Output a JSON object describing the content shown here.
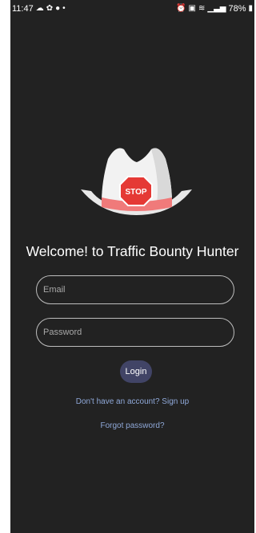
{
  "status_bar": {
    "time": "11:47",
    "battery": "78%"
  },
  "logo": {
    "sign_text": "STOP",
    "icon": "cowboy-hat-stop-sign"
  },
  "login": {
    "welcome": "Welcome! to Traffic Bounty Hunter",
    "email_placeholder": "Email",
    "password_placeholder": "Password",
    "login_label": "Login",
    "signup_link": "Don't have an account? Sign up",
    "forgot_link": "Forgot password?"
  },
  "colors": {
    "background": "#222222",
    "button": "#414466",
    "link": "#8fa8d8"
  }
}
